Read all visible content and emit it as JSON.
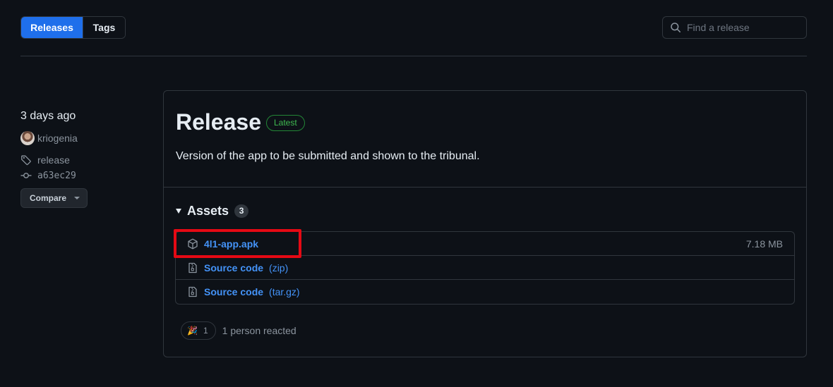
{
  "tabs": {
    "releases_label": "Releases",
    "tags_label": "Tags"
  },
  "search": {
    "placeholder": "Find a release"
  },
  "meta": {
    "date": "3 days ago",
    "author": "kriogenia",
    "tag": "release",
    "commit": "a63ec29",
    "compare_label": "Compare"
  },
  "release": {
    "title": "Release",
    "badge": "Latest",
    "description": "Version of the app to be submitted and shown to the tribunal."
  },
  "assets": {
    "label": "Assets",
    "count": "3",
    "items": [
      {
        "name": "4l1-app.apk",
        "suffix": "",
        "size": "7.18 MB",
        "icon": "package-icon"
      },
      {
        "name": "Source code",
        "suffix": "(zip)",
        "size": "",
        "icon": "file-zip-icon"
      },
      {
        "name": "Source code",
        "suffix": "(tar.gz)",
        "size": "",
        "icon": "file-zip-icon"
      }
    ]
  },
  "reactions": {
    "emoji": "🎉",
    "count": "1",
    "text": "1 person reacted"
  },
  "colors": {
    "background": "#0d1117",
    "border": "#30363d",
    "accent": "#1f6feb",
    "link": "#4493f8",
    "latest": "#3fb950",
    "highlight": "#e50914"
  }
}
